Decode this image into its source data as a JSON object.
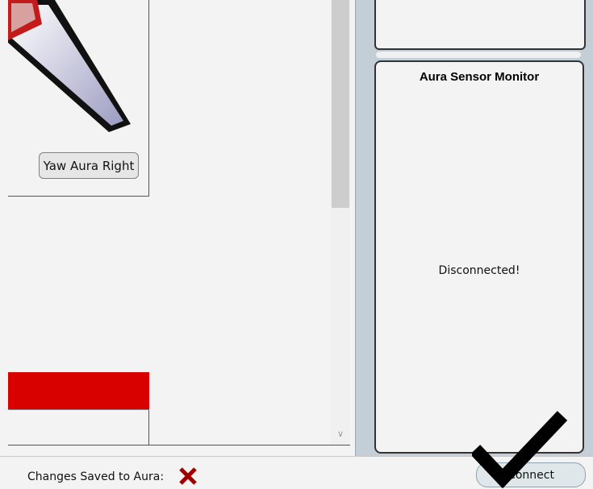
{
  "main": {
    "yaw_right_label": "Yaw Aura Right"
  },
  "monitor": {
    "title": "Aura Sensor Monitor",
    "status": "Disconnected!"
  },
  "statusbar": {
    "saved_label": "Changes Saved to Aura:",
    "saved_icon": "x-icon",
    "saved_color": "#a00000",
    "connect_label": "Connect",
    "overlay_icon": "checkmark-icon"
  }
}
